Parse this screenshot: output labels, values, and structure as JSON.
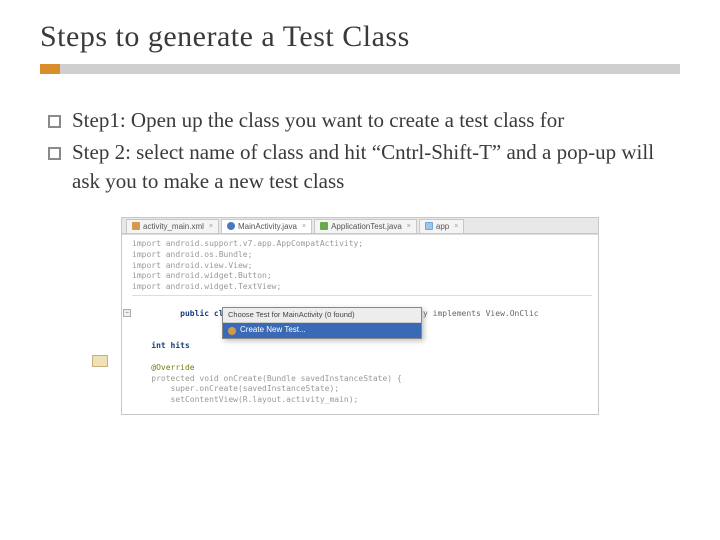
{
  "title": "Steps to generate a Test Class",
  "bullets": [
    "Step1: Open up the class you want to create a test class for",
    "Step 2: select name of class and hit “Cntrl-Shift-T” and a pop-up will ask you to make a new test class"
  ],
  "ide": {
    "tabs": [
      {
        "label": "activity_main.xml",
        "icon": "x"
      },
      {
        "label": "MainActivity.java",
        "icon": "j",
        "selected": true
      },
      {
        "label": "ApplicationTest.java",
        "icon": "g"
      },
      {
        "label": "app",
        "icon": "app"
      }
    ],
    "imports": [
      "import android.support.v7.app.AppCompatActivity;",
      "import android.os.Bundle;",
      "import android.view.View;",
      "import android.widget.Button;",
      "import android.widget.TextView;"
    ],
    "class_decl": {
      "prefix": "public class ",
      "name": "MainActivity",
      "suffix": " extends AppCompatActivity implements View.OnClic"
    },
    "field": "    int hits",
    "annotation": "    @Override",
    "method": "    protected void onCreate(Bundle savedInstanceState) {",
    "body1": "        super.onCreate(savedInstanceState);",
    "body2": "        setContentView(R.layout.activity_main);",
    "popup": {
      "title": "Choose Test for MainActivity (0 found)",
      "item": "Create New Test..."
    }
  }
}
